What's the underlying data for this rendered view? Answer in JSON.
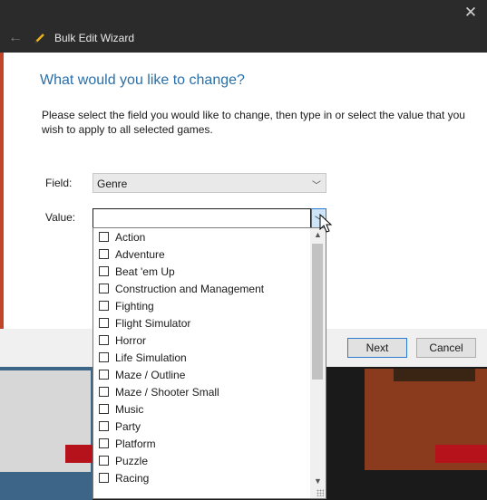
{
  "window": {
    "close_icon": "close-icon"
  },
  "wizard": {
    "title": "Bulk Edit Wizard",
    "back_icon": "back-arrow-icon",
    "app_icon": "pencil-icon",
    "heading": "What would you like to change?",
    "instructions": "Please select the field you would like to change, then type in or select the value that you wish to apply to all selected games."
  },
  "form": {
    "field_label": "Field:",
    "field_value": "Genre",
    "value_label": "Value:",
    "value_text": ""
  },
  "dropdown": {
    "items": [
      {
        "label": "Action",
        "checked": false
      },
      {
        "label": "Adventure",
        "checked": false
      },
      {
        "label": "Beat 'em Up",
        "checked": false
      },
      {
        "label": "Construction and Management",
        "checked": false
      },
      {
        "label": "Fighting",
        "checked": false
      },
      {
        "label": "Flight Simulator",
        "checked": false
      },
      {
        "label": "Horror",
        "checked": false
      },
      {
        "label": "Life Simulation",
        "checked": false
      },
      {
        "label": "Maze / Outline",
        "checked": false
      },
      {
        "label": "Maze / Shooter Small",
        "checked": false
      },
      {
        "label": "Music",
        "checked": false
      },
      {
        "label": "Party",
        "checked": false
      },
      {
        "label": "Platform",
        "checked": false
      },
      {
        "label": "Puzzle",
        "checked": false
      },
      {
        "label": "Racing",
        "checked": false
      }
    ]
  },
  "buttons": {
    "next": "Next",
    "cancel": "Cancel"
  },
  "colors": {
    "heading": "#2b6fa8",
    "accent": "#2d7bd0",
    "titlebar": "#2b2b2b"
  }
}
